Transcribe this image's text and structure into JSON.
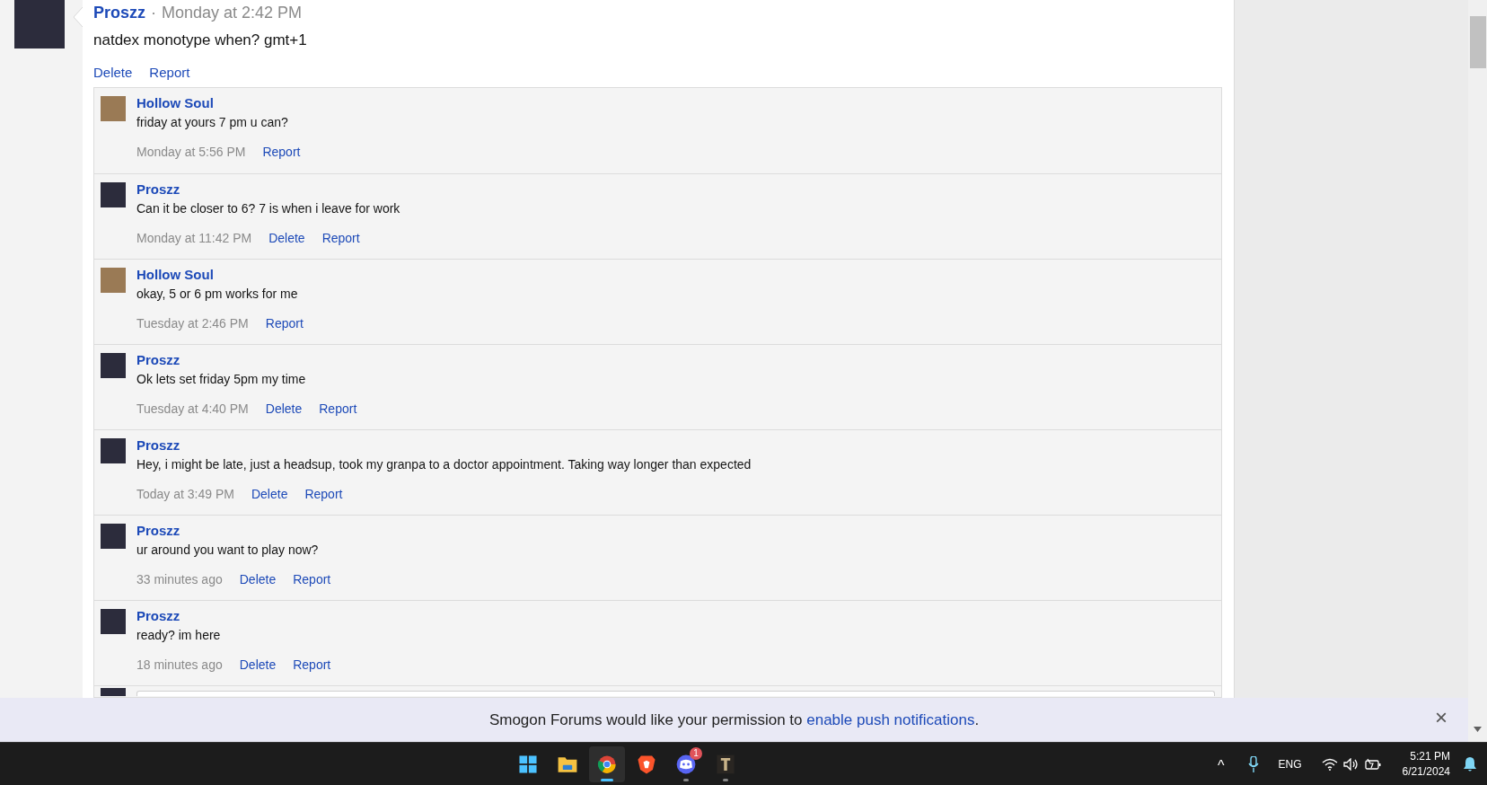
{
  "post": {
    "author": "Proszz",
    "separator": "·",
    "time": "Monday at 2:42 PM",
    "message": "natdex monotype when? gmt+1",
    "actions": [
      "Delete",
      "Report"
    ]
  },
  "comments": [
    {
      "author": "Hollow Soul",
      "color": "#9a7a55",
      "message": "friday at yours 7 pm u can?",
      "time": "Monday at 5:56 PM",
      "actions": [
        "Report"
      ]
    },
    {
      "author": "Proszz",
      "color": "#2c2c3c",
      "message": "Can it be closer to 6? 7 is when i leave for work",
      "time": "Monday at 11:42 PM",
      "actions": [
        "Delete",
        "Report"
      ]
    },
    {
      "author": "Hollow Soul",
      "color": "#9a7a55",
      "message": "okay, 5 or 6 pm works for me",
      "time": "Tuesday at 2:46 PM",
      "actions": [
        "Report"
      ]
    },
    {
      "author": "Proszz",
      "color": "#2c2c3c",
      "message": "Ok lets set friday 5pm my time",
      "time": "Tuesday at 4:40 PM",
      "actions": [
        "Delete",
        "Report"
      ]
    },
    {
      "author": "Proszz",
      "color": "#2c2c3c",
      "message": "Hey, i might be late, just a headsup, took my granpa to a doctor appointment. Taking way longer than expected",
      "time": "Today at 3:49 PM",
      "actions": [
        "Delete",
        "Report"
      ]
    },
    {
      "author": "Proszz",
      "color": "#2c2c3c",
      "message": "ur around you want to play now?",
      "time": "33 minutes ago",
      "actions": [
        "Delete",
        "Report"
      ]
    },
    {
      "author": "Proszz",
      "color": "#2c2c3c",
      "message": "ready? im here",
      "time": "18 minutes ago",
      "actions": [
        "Delete",
        "Report"
      ]
    }
  ],
  "notification": {
    "text": "Smogon Forums would like your permission to ",
    "link": "enable push notifications",
    "end": ".",
    "close": "×"
  },
  "taskbar": {
    "apps": [
      {
        "kind": "start",
        "selected": false,
        "running": false
      },
      {
        "kind": "folder",
        "selected": false,
        "running": false
      },
      {
        "kind": "browser",
        "selected": true,
        "running": true
      },
      {
        "kind": "lion",
        "selected": false,
        "running": false
      },
      {
        "kind": "chat",
        "selected": false,
        "running": true,
        "badge": "1"
      },
      {
        "kind": "game",
        "selected": false,
        "running": true
      }
    ],
    "tray_caret": "^",
    "language": "ENG",
    "time": "5:21 PM",
    "date": "6/21/2024"
  }
}
